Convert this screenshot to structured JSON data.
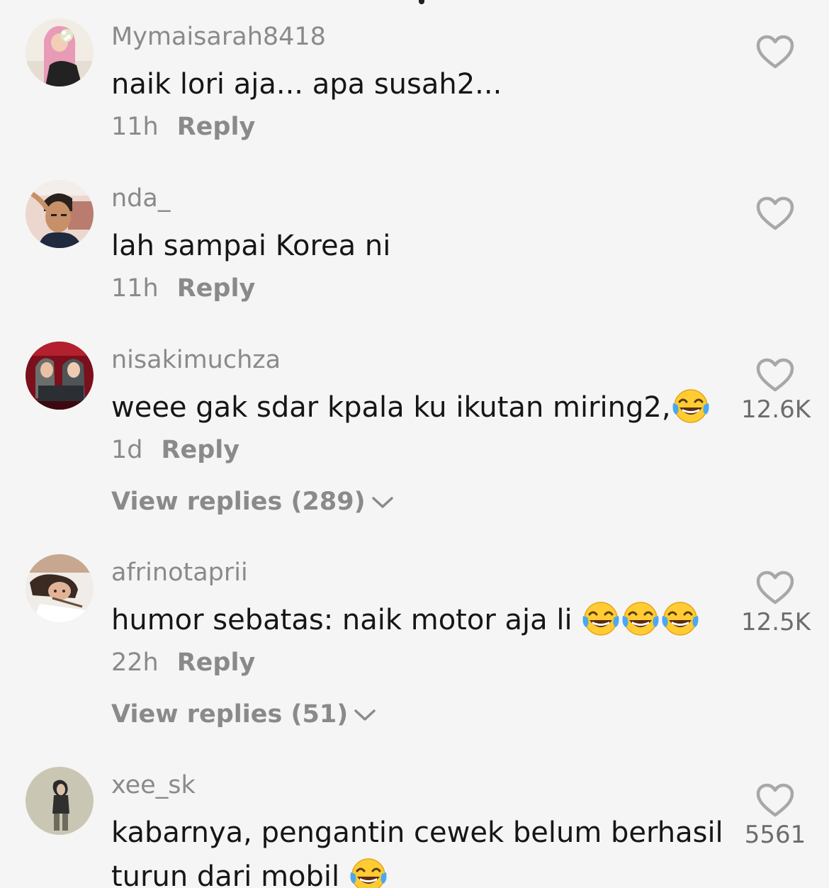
{
  "comments": [
    {
      "username": "Mymaisarah8418",
      "text": "naik lori aja... apa susah2...",
      "time": "11h",
      "reply_label": "Reply",
      "likes": "",
      "view_replies": ""
    },
    {
      "username": "nda_",
      "text": "lah sampai Korea ni",
      "time": "11h",
      "reply_label": "Reply",
      "likes": "",
      "view_replies": ""
    },
    {
      "username": "nisakimuchza",
      "text": "weee gak sdar kpala ku ikutan miring2,",
      "emoji_count": 1,
      "time": "1d",
      "reply_label": "Reply",
      "likes": "12.6K",
      "view_replies": "View replies (289)"
    },
    {
      "username": "afrinotaprii",
      "text": "humor sebatas: naik motor aja li ",
      "emoji_count": 3,
      "time": "22h",
      "reply_label": "Reply",
      "likes": "12.5K",
      "view_replies": "View replies (51)"
    },
    {
      "username": "xee_sk",
      "text": "kabarnya, pengantin cewek belum berhasil turun dari mobil ",
      "emoji_count": 1,
      "time": "",
      "reply_label": "",
      "likes": "5561",
      "view_replies": ""
    }
  ],
  "icons": {
    "like": "heart-outline-icon",
    "expand": "chevron-down-icon",
    "emoji": "face-with-tears-of-joy"
  },
  "colors": {
    "background": "#f5f5f5",
    "username": "#8a8a8a",
    "text": "#161616",
    "like_count": "#6c6c6c"
  }
}
